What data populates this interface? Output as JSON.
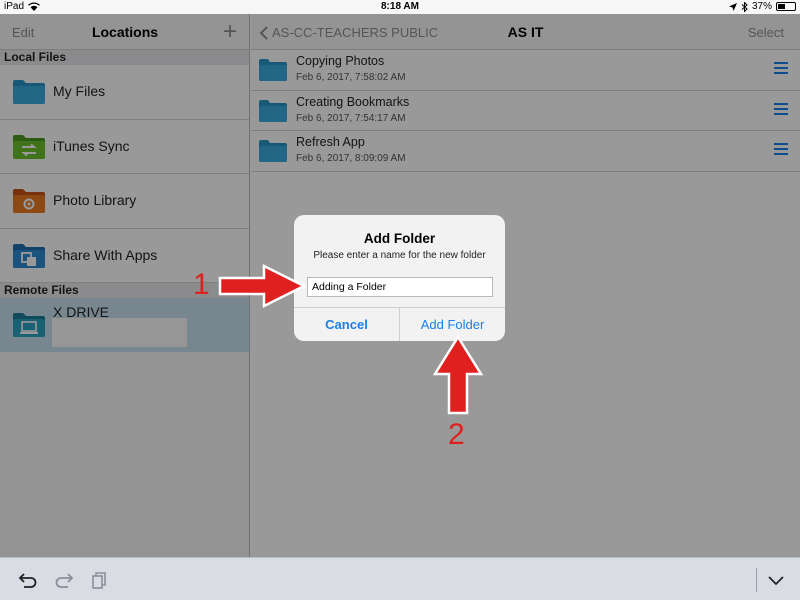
{
  "status_bar": {
    "device": "iPad",
    "time": "8:18 AM",
    "battery_percent": "37%",
    "battery_level": 0.37
  },
  "left_panel": {
    "edit_label": "Edit",
    "title": "Locations",
    "add_label": "+",
    "local_header": "Local Files",
    "local_items": [
      {
        "label": "My Files",
        "icon": "folder-icon"
      },
      {
        "label": "iTunes Sync",
        "icon": "itunes-sync-icon"
      },
      {
        "label": "Photo Library",
        "icon": "photo-library-icon"
      },
      {
        "label": "Share With Apps",
        "icon": "share-with-apps-icon"
      }
    ],
    "remote_header": "Remote Files",
    "remote_items": [
      {
        "label": "X DRIVE",
        "icon": "network-drive-icon"
      }
    ]
  },
  "right_panel": {
    "back_label": "AS-CC-TEACHERS PUBLIC",
    "title": "AS IT",
    "select_label": "Select",
    "files": [
      {
        "name": "Copying Photos",
        "date": "Feb 6, 2017, 7:58:02 AM"
      },
      {
        "name": "Creating Bookmarks",
        "date": "Feb 6, 2017, 7:54:17 AM"
      },
      {
        "name": "Refresh App",
        "date": "Feb 6, 2017, 8:09:09 AM"
      }
    ]
  },
  "dialog": {
    "title": "Add Folder",
    "message": "Please enter a name for the new folder",
    "input_value": "Adding a Folder",
    "cancel_label": "Cancel",
    "confirm_label": "Add Folder"
  },
  "annotations": {
    "step1": "1",
    "step2": "2",
    "arrow_color": "#e0201f"
  },
  "colors": {
    "accent": "#1a7fe8",
    "folder": "#2b95c9",
    "selected_row": "#c9dff0"
  }
}
